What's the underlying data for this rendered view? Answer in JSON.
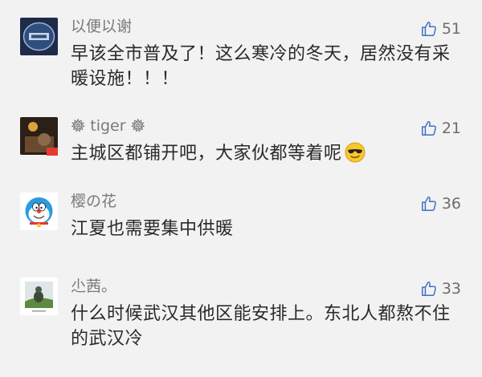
{
  "comments": [
    {
      "username": "以便以谢",
      "likes": "51",
      "text": "早该全市普及了！这么寒冷的冬天，居然没有采暖设施！！！"
    },
    {
      "username": "𖣔 tiger 𖣔",
      "likes": "21",
      "text": "主城区都铺开吧，大家伙都等着呢"
    },
    {
      "username": "樱の花",
      "likes": "36",
      "text": "江夏也需要集中供暖"
    },
    {
      "username": "尐茜。",
      "likes": "33",
      "text": "什么时候武汉其他区能安排上。东北人都熬不住的武汉冷"
    }
  ],
  "icons": {
    "like": "thumbs-up-icon",
    "emoji": "sunglasses-emoji-icon"
  }
}
